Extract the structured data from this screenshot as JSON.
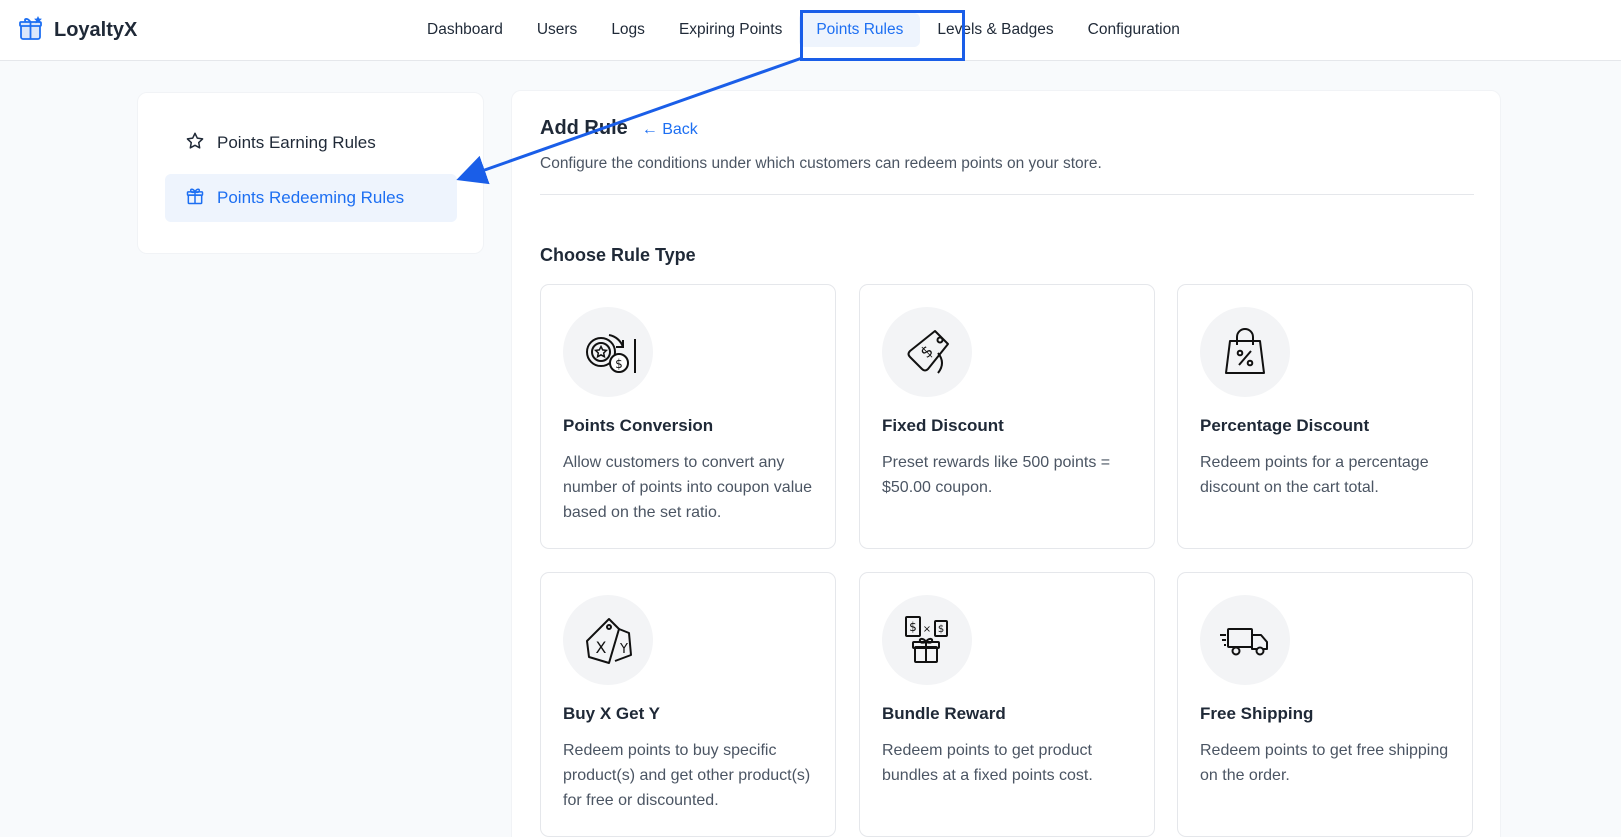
{
  "app": {
    "name": "LoyaltyX",
    "logo_icon": "gift-star-icon",
    "brand_color": "#1d6ff2"
  },
  "nav": {
    "items": [
      {
        "label": "Dashboard"
      },
      {
        "label": "Users"
      },
      {
        "label": "Logs"
      },
      {
        "label": "Expiring Points"
      },
      {
        "label": "Points Rules",
        "active": true
      },
      {
        "label": "Levels & Badges"
      },
      {
        "label": "Configuration"
      }
    ]
  },
  "sidebar": {
    "items": [
      {
        "label": "Points Earning Rules",
        "icon": "star-icon"
      },
      {
        "label": "Points Redeeming Rules",
        "icon": "gift-icon",
        "active": true
      }
    ]
  },
  "main": {
    "title": "Add Rule",
    "back_label": "← Back",
    "subtitle": "Configure the conditions under which customers can redeem points on your store.",
    "section_title": "Choose Rule Type",
    "cards": [
      {
        "title": "Points Conversion",
        "desc": "Allow customers to convert any number of points into coupon value based on the set ratio.",
        "icon": "points-conversion-icon"
      },
      {
        "title": "Fixed Discount",
        "desc": "Preset rewards like 500 points = $50.00 coupon.",
        "icon": "price-tag-icon"
      },
      {
        "title": "Percentage Discount",
        "desc": "Redeem points for a percentage discount on the cart total.",
        "icon": "shopping-bag-percent-icon"
      },
      {
        "title": "Buy X Get Y",
        "desc": "Redeem points to buy specific product(s) and get other product(s) for free or discounted.",
        "icon": "xy-tags-icon"
      },
      {
        "title": "Bundle Reward",
        "desc": "Redeem points to get product bundles at a fixed points cost.",
        "icon": "bundle-gift-icon"
      },
      {
        "title": "Free Shipping",
        "desc": "Redeem points to get free shipping on the order.",
        "icon": "delivery-truck-icon"
      }
    ]
  },
  "annotation": {
    "highlight_color": "#1a5ee8",
    "arrow_color": "#1a5ee8"
  }
}
